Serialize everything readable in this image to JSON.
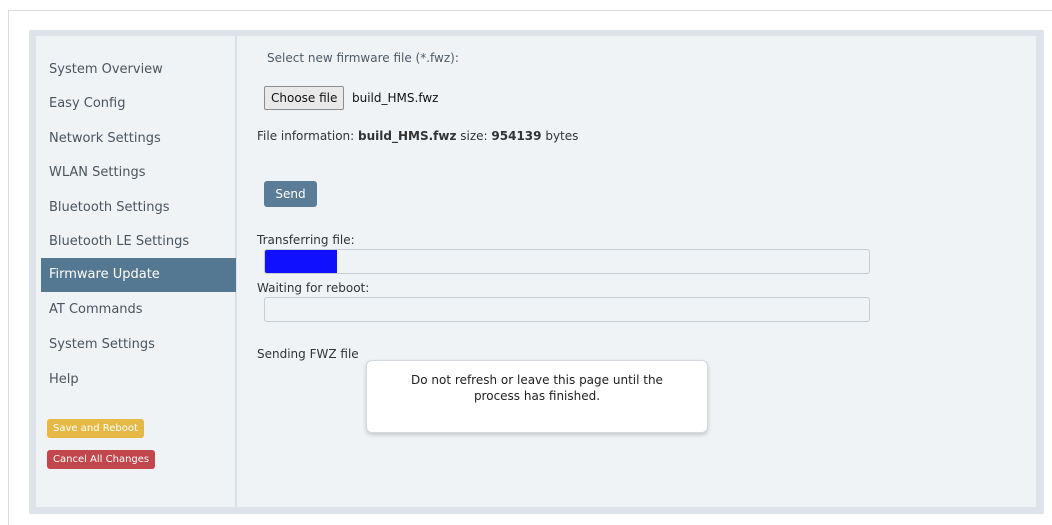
{
  "sidebar": {
    "items": [
      {
        "label": "System Overview"
      },
      {
        "label": "Easy Config"
      },
      {
        "label": "Network Settings"
      },
      {
        "label": "WLAN Settings"
      },
      {
        "label": "Bluetooth Settings"
      },
      {
        "label": "Bluetooth LE Settings"
      },
      {
        "label": "Firmware Update",
        "active": true
      },
      {
        "label": "AT Commands"
      },
      {
        "label": "System Settings"
      },
      {
        "label": "Help"
      }
    ],
    "save_label": "Save and Reboot",
    "cancel_label": "Cancel All Changes"
  },
  "main": {
    "select_label": "Select new firmware file (*.fwz):",
    "choose_button": "Choose file",
    "chosen_file": "build_HMS.fwz",
    "info_prefix": "File information: ",
    "info_filename": "build_HMS.fwz",
    "info_size_label": " size: ",
    "info_size": "954139",
    "info_unit": " bytes",
    "send_button": "Send",
    "transfer_label": "Transferring file:",
    "transfer_progress": 0.12,
    "reboot_label": "Waiting for reboot:",
    "reboot_progress": 0,
    "status_text": "Sending FWZ file"
  },
  "notice": {
    "text": "Do not refresh or leave this page until the process has finished."
  },
  "colors": {
    "active_nav": "#547891",
    "send_button": "#5a7c97",
    "save_button": "#e6b946",
    "cancel_button": "#c1474d",
    "progress_fill": "#1010ff"
  }
}
